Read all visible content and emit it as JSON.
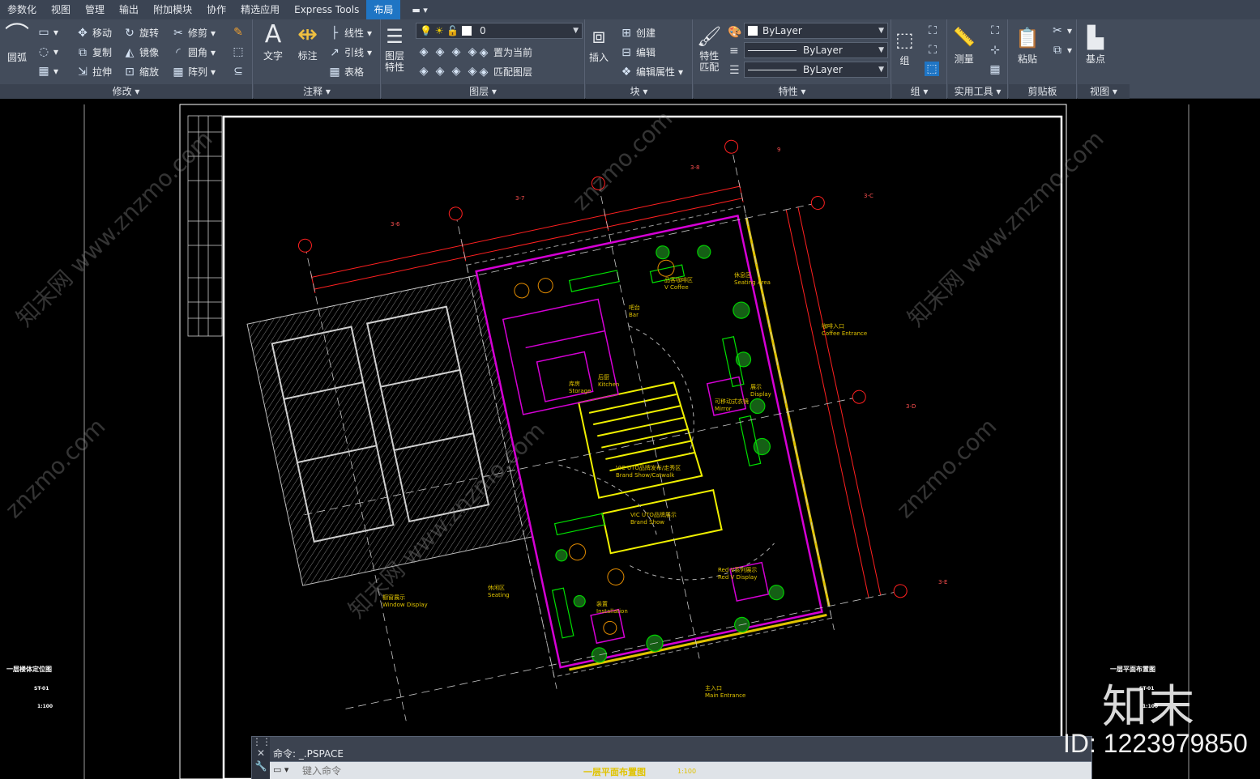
{
  "menu": {
    "tabs": [
      "参数化",
      "视图",
      "管理",
      "输出",
      "附加模块",
      "协作",
      "精选应用",
      "Express Tools",
      "布局"
    ],
    "active_tab": "布局",
    "extra": "▬ ▾"
  },
  "ribbon": {
    "modify": {
      "footer": "修改 ▾",
      "arc": "圆弧",
      "move": "移动",
      "rotate": "旋转",
      "trim": "修剪",
      "copy": "复制",
      "mirror": "镜像",
      "fillet": "圆角",
      "stretch": "拉伸",
      "scale": "缩放",
      "array": "阵列"
    },
    "annotation": {
      "footer": "注释 ▾",
      "text": "文字",
      "dimension": "标注",
      "linear": "线性",
      "leader": "引线",
      "table": "表格"
    },
    "layers": {
      "footer": "图层 ▾",
      "layer_properties": "图层\n特性",
      "current_layer": "0",
      "set_current": "置为当前",
      "match_layer": "匹配图层"
    },
    "block": {
      "footer": "块 ▾",
      "insert": "插入",
      "create": "创建",
      "edit": "编辑",
      "edit_attributes": "编辑属性"
    },
    "properties": {
      "footer": "特性 ▾",
      "match": "特性\n匹配",
      "color": "ByLayer",
      "linetype": "ByLayer",
      "lineweight": "ByLayer"
    },
    "groups": {
      "footer": "组 ▾",
      "group": "组"
    },
    "utilities": {
      "footer": "实用工具 ▾",
      "measure": "测量"
    },
    "clipboard": {
      "footer": "剪贴板",
      "paste": "粘贴"
    },
    "view": {
      "footer": "视图 ▾",
      "base": "基点"
    }
  },
  "drawing": {
    "axis_labels": [
      "3-6",
      "3-7",
      "3-8",
      "9",
      "3-C",
      "3-D",
      "3-E"
    ],
    "room_labels": [
      {
        "cn": "品客咖啡区",
        "en": "V Coffee"
      },
      {
        "cn": "休息区",
        "en": "Seating Area"
      },
      {
        "cn": "咖啡入口",
        "en": "Coffee Entrance"
      },
      {
        "cn": "吧台",
        "en": "Bar"
      },
      {
        "cn": "库房",
        "en": "Storage"
      },
      {
        "cn": "后厨",
        "en": "Kitchen"
      },
      {
        "cn": "展示",
        "en": "Display"
      },
      {
        "cn": "可移动式衣镜",
        "en": "Mirror"
      },
      {
        "cn": "VIC UTO品牌发布/走秀区",
        "en": "Brand Show/Catwalk"
      },
      {
        "cn": "VIC UTO品牌展示",
        "en": "Brand Show"
      },
      {
        "cn": "橱窗展示",
        "en": "Window Display"
      },
      {
        "cn": "Red V系列展示",
        "en": "Red V Display"
      },
      {
        "cn": "休闲区",
        "en": "Seating"
      },
      {
        "cn": "装置",
        "en": "Installation"
      },
      {
        "cn": "主入口",
        "en": "Main Entrance"
      }
    ],
    "left_caption": "一层楼体定位图",
    "left_code": "ST-01",
    "left_scale": "1:100",
    "right_caption": "一层平面布置图",
    "right_code": "ST-01",
    "right_scale": "1:100"
  },
  "command": {
    "history": "命令:  _.PSPACE",
    "placeholder": "键入命令",
    "layout_caption": "一层平面布置图",
    "layout_scale": "1:100"
  },
  "watermark": {
    "text": "znzmo.com",
    "text_url": "知末网 www.znzmo.com",
    "brand": "知末",
    "id": "ID: 1223979850"
  }
}
